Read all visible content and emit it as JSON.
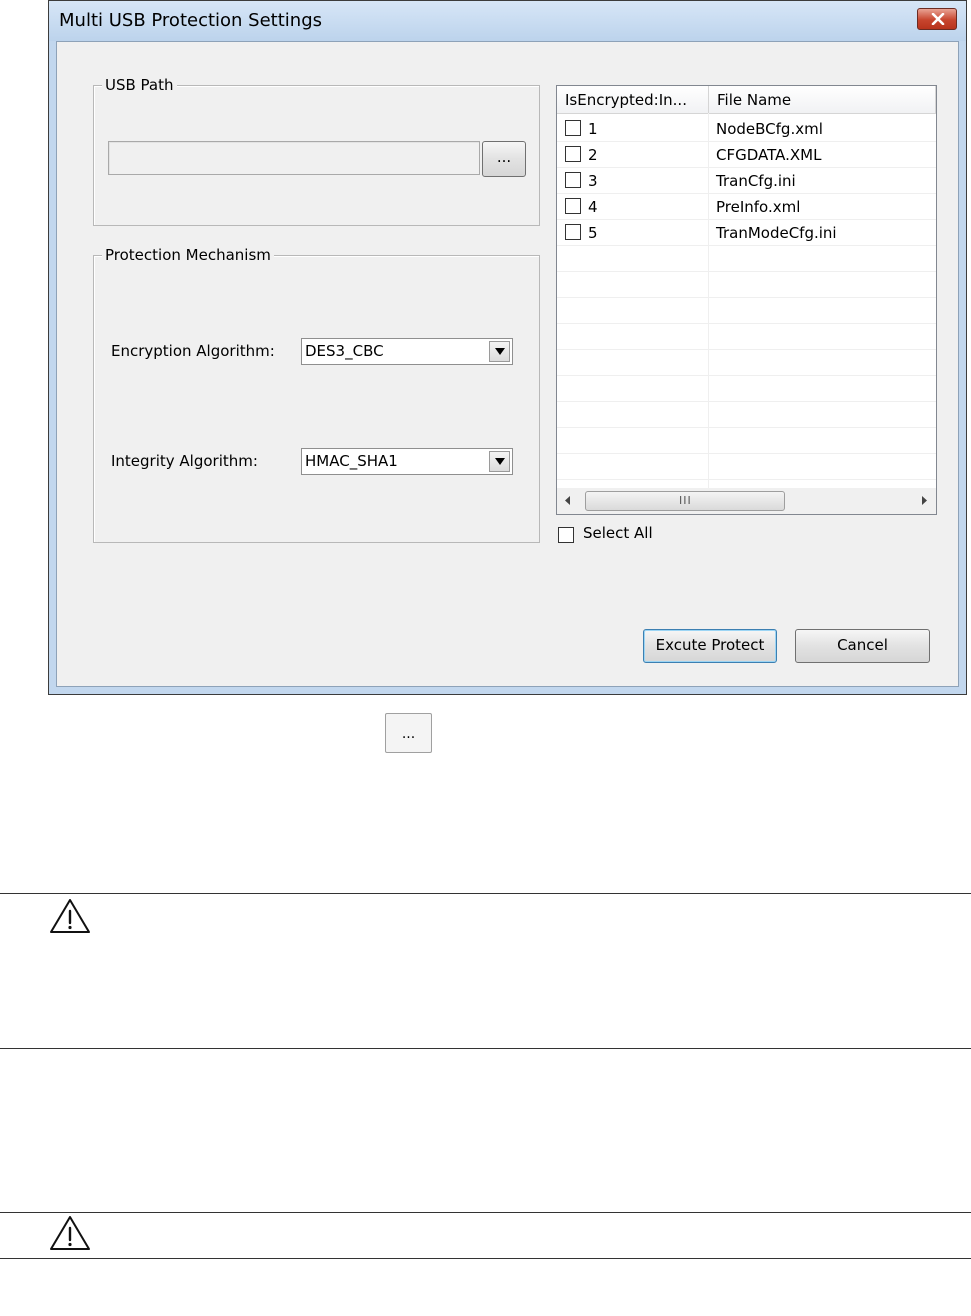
{
  "dialog": {
    "title": "Multi USB Protection Settings",
    "usb_path": {
      "legend": "USB Path",
      "input_value": "",
      "browse_label": "..."
    },
    "protection": {
      "legend": "Protection Mechanism",
      "encryption_label": "Encryption Algorithm:",
      "encryption_value": "DES3_CBC",
      "integrity_label": "Integrity Algorithm:",
      "integrity_value": "HMAC_SHA1"
    },
    "file_list": {
      "columns": [
        "IsEncrypted:In...",
        "File Name"
      ],
      "rows": [
        {
          "index": "1",
          "file": "NodeBCfg.xml",
          "checked": false
        },
        {
          "index": "2",
          "file": "CFGDATA.XML",
          "checked": false
        },
        {
          "index": "3",
          "file": "TranCfg.ini",
          "checked": false
        },
        {
          "index": "4",
          "file": "PreInfo.xml",
          "checked": false
        },
        {
          "index": "5",
          "file": "TranModeCfg.ini",
          "checked": false
        }
      ],
      "scroll_grip": "III"
    },
    "select_all_label": "Select All",
    "select_all_checked": false,
    "execute_label": "Excute Protect",
    "cancel_label": "Cancel"
  },
  "below": {
    "browse_icon_label": "..."
  },
  "colors": {
    "window_frame": "#c2d7ee",
    "client_bg": "#f0f0f0",
    "close_button": "#c7452e"
  },
  "icons": [
    "close-icon",
    "dropdown-arrow-icon",
    "scroll-left-icon",
    "scroll-right-icon",
    "warning-icon"
  ]
}
